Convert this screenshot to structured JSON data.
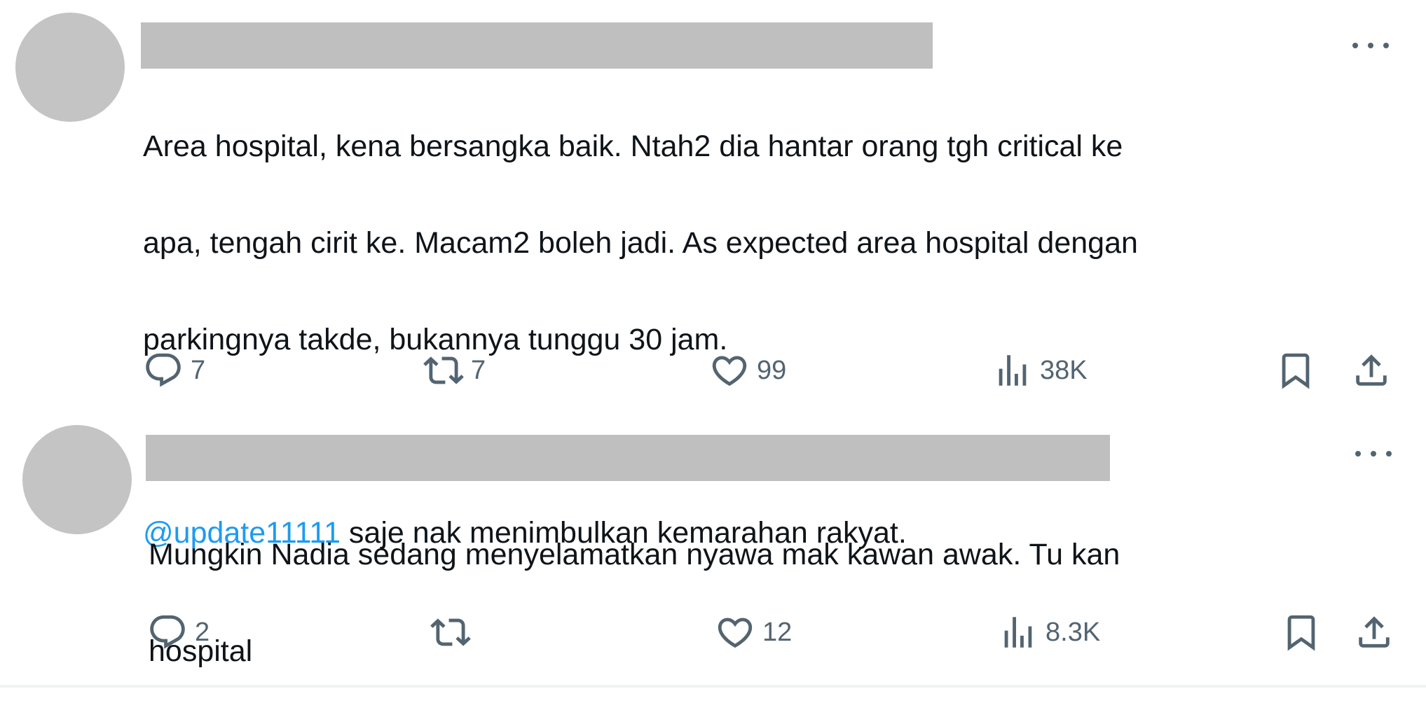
{
  "tweets": [
    {
      "text_lines": [
        "Area hospital, kena bersangka baik. Ntah2 dia hantar orang tgh critical ke",
        "apa, tengah cirit ke. Macam2 boleh jadi. As expected area hospital dengan",
        "parkingnya takde, bukannya tunggu 30 jam."
      ],
      "mention": "@update11111",
      "mention_text": " saje nak menimbulkan kemarahan rakyat.",
      "stats": {
        "replies": "7",
        "retweets": "7",
        "likes": "99",
        "views": "38K"
      }
    },
    {
      "text_lines": [
        "Mungkin Nadia sedang menyelamatkan nyawa mak kawan awak. Tu kan",
        "hospital"
      ],
      "stats": {
        "replies": "2",
        "retweets": "",
        "likes": "12",
        "views": "8.3K"
      }
    }
  ],
  "icons": {
    "reply": "speech-bubble-icon",
    "retweet": "retweet-icon",
    "like": "heart-icon",
    "views": "bar-chart-icon",
    "bookmark": "bookmark-icon",
    "share": "share-upload-icon",
    "more": "more-horizontal-icon"
  },
  "colors": {
    "text": "#0f1419",
    "secondary": "#536471",
    "mention": "#1d9bf0",
    "placeholder": "#bfbfbf"
  }
}
